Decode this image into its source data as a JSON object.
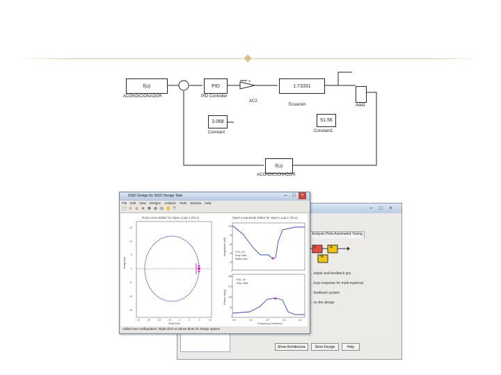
{
  "simulink": {
    "blocks": {
      "gain1": "f(u)",
      "pid": "PID",
      "saturation_plus": "+",
      "transfer_fcn": "1.73331",
      "const1": "3.068",
      "const2": "51.56",
      "gain2": "f(u)"
    },
    "labels": {
      "gain1": "ACONDICIONADOR",
      "pid": "PID Controller",
      "sum_in": "AC2",
      "transfer_fcn": "Ecuacion",
      "add": "Add1",
      "const1": "Constant",
      "const2": "Constant1",
      "gain2": "ACONDICIONADOR"
    }
  },
  "siso_back": {
    "tabs": "Analysis Plots   Automated Tuning",
    "block_c": "C",
    "block_g": "G",
    "block_h": "H",
    "lines": [
      "... stable and feedback gra",
      "... loop response for multi-input/out",
      "... feedback system",
      "... on the design"
    ],
    "buttons": [
      "Show Architecture",
      "Store Design",
      "Help"
    ]
  },
  "siso_front": {
    "title": "SISO Design for SISO Design Task",
    "menus": [
      "File",
      "Edit",
      "View",
      "Designs",
      "Analysis",
      "Tools",
      "Window",
      "Help"
    ],
    "toolbar_icons": [
      "select-icon",
      "add-pole-icon",
      "add-zero-icon",
      "delete-icon",
      "drag-icon",
      "zoom-in-icon",
      "zoom-out-icon",
      "pan-icon",
      "help-icon"
    ],
    "status": "Added new configuration. Right-click on above plots for design options.",
    "root_locus": {
      "title": "Root Locus Editor for Open Loop 1 (OL1)",
      "xlabel": "Real Axis",
      "ylabel": "Imag Axis",
      "xticks": [
        "-25",
        "-20",
        "-15",
        "-10",
        "-5",
        "0",
        "5",
        "10"
      ],
      "yticks": [
        "15",
        "10",
        "5",
        "0",
        "-5",
        "-10",
        "-15"
      ]
    },
    "bode": {
      "title": "Open-Loop Bode Editor for Open Loop 1 (OL1)",
      "mag_ylabel": "Magnitude (dB)",
      "phase_ylabel": "Phase (deg)",
      "xlabel": "Frequency (rad/sec)",
      "mag_yticks": [
        "100",
        "80",
        "60",
        "40",
        "20",
        "0"
      ],
      "phase_yticks": [
        "360",
        "270",
        "180",
        "90",
        "0"
      ],
      "xticks": [
        "10²",
        "10¹",
        "10⁰",
        "10¹",
        "10²"
      ],
      "legend_mag": [
        "G.M.: Inf",
        "Freq: NaN",
        "Stable loop"
      ],
      "legend_phase": [
        "P.M.: Inf",
        "Freq: NaN"
      ]
    },
    "colors": {
      "curve": "#3344cc",
      "marker": "#e01ccc",
      "axis": "#444444"
    }
  }
}
